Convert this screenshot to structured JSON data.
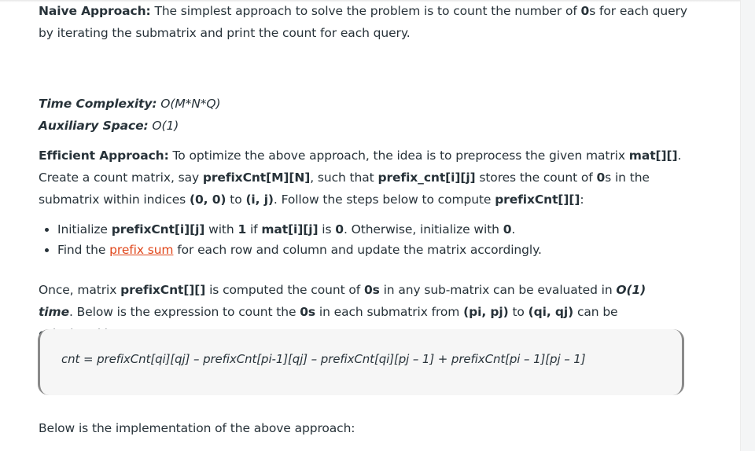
{
  "naive": {
    "heading": "Naive Approach:",
    "text_1": " The simplest approach to solve the problem is to count the number of ",
    "zero": "0",
    "text_2": "s for each query by iterating the submatrix and print the count for each query."
  },
  "complexity": {
    "time_label": "Time Complexity:",
    "time_value": " O(M*N*Q)",
    "space_label": "Auxiliary Space:",
    "space_value": " O(1)"
  },
  "efficient": {
    "heading": "Efficient Approach:",
    "t1": " To optimize the above approach, the idea is to preprocess the given matrix ",
    "b1": "mat[][]",
    "t2": ". Create a count matrix, say ",
    "b2": "prefixCnt[M][N]",
    "t3": ", such that ",
    "b3": "prefix_cnt[i][j]",
    "t4": " stores the count of ",
    "b4": "0",
    "t5": "s in the submatrix within indices ",
    "b5": "(0, 0)",
    "t6": " to ",
    "b6": "(i, j)",
    "t7": ". Follow the steps below to compute ",
    "b7": "prefixCnt[][]",
    "t8": ":"
  },
  "steps": [
    {
      "t1": "Initialize ",
      "b1": "prefixCnt[i][j]",
      "t2": " with ",
      "b2": "1",
      "t3": " if ",
      "b3": "mat[i][j]",
      "t4": " is ",
      "b4": "0",
      "t5": ". Otherwise, initialize with ",
      "b5": "0",
      "t6": "."
    },
    {
      "t1": "Find the ",
      "link": "prefix sum",
      "t2": " for each row and column and update the matrix accordingly."
    }
  ],
  "once": {
    "t1": "Once, matrix ",
    "b1": "prefixCnt[][]",
    "t2": " is computed the count of ",
    "b2": "0s",
    "t3": " in any sub-matrix can be evaluated in ",
    "bi": "O(1) time",
    "t4": ". Below is the expression to count the ",
    "b3": "0s",
    "t5": " in each submatrix from ",
    "b4": "(pi, pj)",
    "t6": " to ",
    "b5": "(qi, qj)",
    "t7": " can be calculated by:"
  },
  "formula": "cnt = prefixCnt[qi][qj] – prefixCnt[pi-1][qj] – prefixCnt[qi][pj – 1] + prefixCnt[pi – 1][pj – 1]",
  "implementation": "Below is the implementation of the above approach:"
}
